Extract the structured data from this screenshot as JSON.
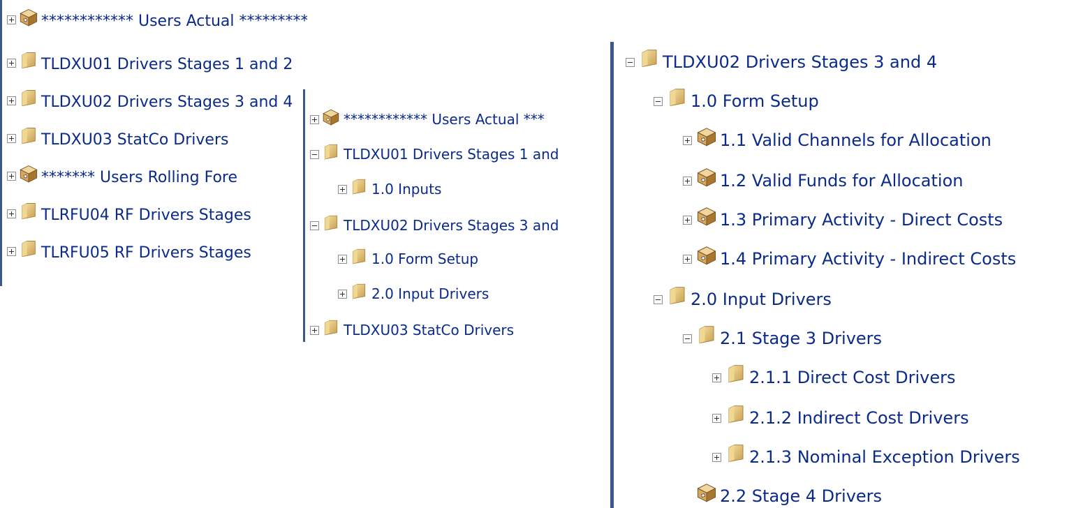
{
  "panel_left": {
    "items": [
      {
        "label": "************ Users Actual ************",
        "icon": "cube-icon",
        "toggle": "plus"
      },
      {
        "label": "TLDXU01 Drivers Stages 1 and 2",
        "icon": "folder-icon",
        "toggle": "plus"
      },
      {
        "label": "TLDXU02 Drivers Stages 3 and 4",
        "icon": "folder-icon",
        "toggle": "plus"
      },
      {
        "label": "TLDXU03 StatCo Drivers",
        "icon": "folder-icon",
        "toggle": "plus"
      },
      {
        "label": "******* Users Rolling Fore",
        "icon": "cube-icon",
        "toggle": "plus"
      },
      {
        "label": "TLRFU04 RF Drivers Stages",
        "icon": "folder-icon",
        "toggle": "plus"
      },
      {
        "label": "TLRFU05 RF Drivers Stages",
        "icon": "folder-icon",
        "toggle": "plus"
      }
    ]
  },
  "panel_middle": {
    "items": [
      {
        "label": "************ Users Actual ***",
        "icon": "cube-icon",
        "toggle": "plus"
      },
      {
        "label": "TLDXU01 Drivers Stages 1 and",
        "icon": "folder-icon",
        "toggle": "minus"
      },
      {
        "label": "1.0 Inputs",
        "icon": "folder-icon",
        "toggle": "plus"
      },
      {
        "label": "TLDXU02 Drivers Stages 3 and",
        "icon": "folder-icon",
        "toggle": "minus"
      },
      {
        "label": "1.0 Form Setup",
        "icon": "folder-icon",
        "toggle": "plus"
      },
      {
        "label": "2.0 Input Drivers",
        "icon": "folder-icon",
        "toggle": "plus"
      },
      {
        "label": "TLDXU03 StatCo Drivers",
        "icon": "folder-icon",
        "toggle": "plus"
      }
    ]
  },
  "panel_right": {
    "items": [
      {
        "label": "TLDXU02 Drivers Stages 3 and 4",
        "icon": "folder-icon",
        "toggle": "minus"
      },
      {
        "label": "1.0 Form Setup",
        "icon": "folder-icon",
        "toggle": "minus"
      },
      {
        "label": "1.1 Valid Channels for Allocation",
        "icon": "cube-icon",
        "toggle": "plus"
      },
      {
        "label": "1.2 Valid Funds for Allocation",
        "icon": "cube-icon",
        "toggle": "plus"
      },
      {
        "label": "1.3 Primary Activity - Direct Costs",
        "icon": "cube-icon",
        "toggle": "plus"
      },
      {
        "label": "1.4 Primary Activity - Indirect Costs",
        "icon": "cube-icon",
        "toggle": "plus"
      },
      {
        "label": "2.0 Input Drivers",
        "icon": "folder-icon",
        "toggle": "minus"
      },
      {
        "label": "2.1 Stage 3 Drivers",
        "icon": "folder-icon",
        "toggle": "minus"
      },
      {
        "label": "2.1.1 Direct Cost Drivers",
        "icon": "folder-icon",
        "toggle": "plus"
      },
      {
        "label": "2.1.2 Indirect Cost Drivers",
        "icon": "folder-icon",
        "toggle": "plus"
      },
      {
        "label": "2.1.3 Nominal Exception Drivers",
        "icon": "folder-icon",
        "toggle": "plus"
      },
      {
        "label": "2.2 Stage 4 Drivers",
        "icon": "cube-icon",
        "toggle": "none"
      }
    ]
  },
  "colors": {
    "text": "#0a2a8c",
    "border": "#3b5a86",
    "folder": "#e2c47e",
    "cube": "#c29a55"
  }
}
